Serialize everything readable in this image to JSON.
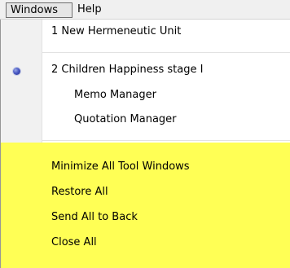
{
  "menubar": {
    "windows_label": "Windows",
    "help_label": "Help"
  },
  "window_list": [
    {
      "label": "1 New Hermeneutic Unit",
      "active": false
    },
    {
      "label": "2 Children  Happiness stage I",
      "active": true
    }
  ],
  "managers": [
    {
      "label": "Memo Manager"
    },
    {
      "label": "Quotation Manager"
    }
  ],
  "actions": [
    {
      "label": "Minimize All Tool Windows"
    },
    {
      "label": "Restore All"
    },
    {
      "label": "Send All to Back"
    },
    {
      "label": "Close All"
    }
  ],
  "highlight_color": "#ffff55",
  "bullet_icon": "radio-bullet-icon"
}
